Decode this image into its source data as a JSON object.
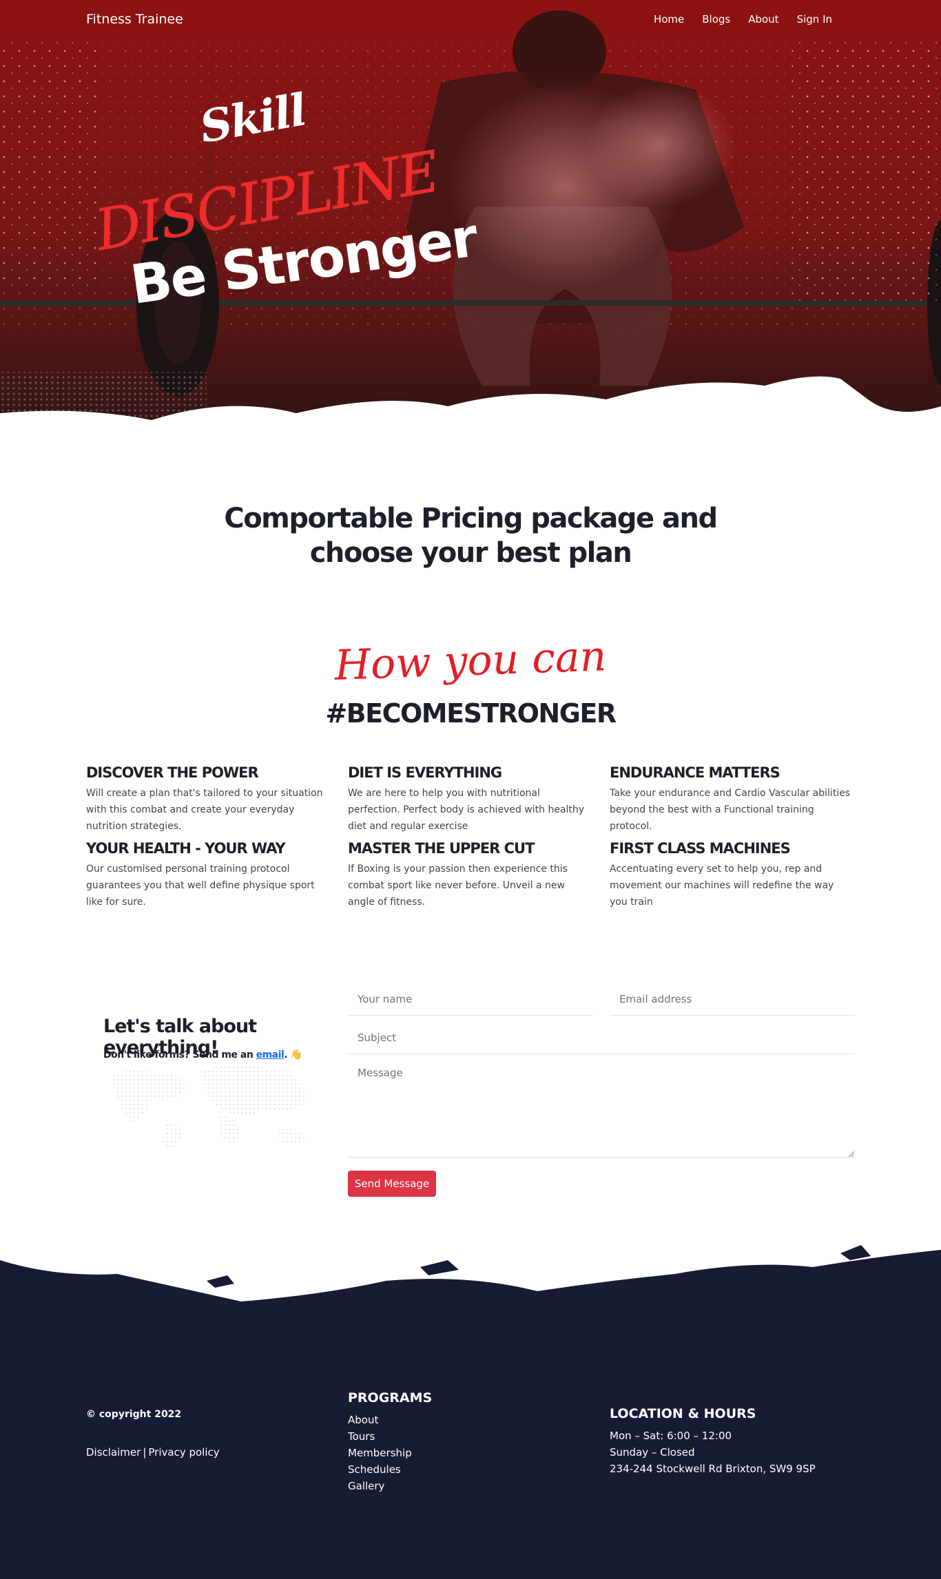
{
  "nav": {
    "brand": "Fitness Trainee",
    "links": [
      "Home",
      "Blogs",
      "About",
      "Sign In"
    ]
  },
  "hero": {
    "line1": "Skill",
    "line2": "DISCIPLINE",
    "line3": "Be Stronger"
  },
  "pricing": {
    "title_line1": "Comportable Pricing package and",
    "title_line2": "choose your best plan"
  },
  "how": {
    "script": "How you can",
    "hashtag": "#BECOMESTRONGER"
  },
  "features": [
    {
      "title": "DISCOVER THE POWER",
      "text": "Will create a plan that's tailored to your situation with this combat and create your everyday nutrition strategies."
    },
    {
      "title": "DIET IS EVERYTHING",
      "text": "We are here to help you with nutritional perfection. Perfect body is achieved with healthy diet and regular exercise"
    },
    {
      "title": "ENDURANCE MATTERS",
      "text": "Take your endurance and Cardio Vascular abilities beyond the best with a Functional training protocol."
    },
    {
      "title": "YOUR HEALTH - YOUR WAY",
      "text": "Our customised personal training protocol guarantees you that well define physique sport like for sure."
    },
    {
      "title": "MASTER THE UPPER CUT",
      "text": "If Boxing is your passion then experience this combat sport like never before. Unveil a new angle of fitness."
    },
    {
      "title": "FIRST CLASS MACHINES",
      "text": "Accentuating every set to help you, rep and movement our machines will redefine the way you train"
    }
  ],
  "contact": {
    "title": "Let's talk about everything!",
    "sub_prefix": "Don't like forms? Send me an",
    "sub_link": "email",
    "sub_suffix": ". 👋",
    "name_placeholder": "Your name",
    "email_placeholder": "Email address",
    "subject_placeholder": "Subject",
    "message_placeholder": "Message",
    "send_label": "Send Message"
  },
  "footer": {
    "copyright": "© copyright 2022",
    "disclaimer": "Disclaimer",
    "separator": "|",
    "privacy": "Privacy policy",
    "programs_title": "PROGRAMS",
    "programs": [
      "About",
      "Tours",
      "Membership",
      "Schedules",
      "Gallery"
    ],
    "location_title": "LOCATION & HOURS",
    "location_lines": [
      "Mon – Sat: 6:00 – 12:00",
      "Sunday – Closed",
      "234-244 Stockwell Rd Brixton, SW9 9SP"
    ]
  },
  "colors": {
    "hero_red": "#8a1414",
    "accent_red": "#e31e24",
    "button_red": "#dc3545",
    "footer_navy": "#171b33",
    "heading_dark": "#1d1f2b"
  }
}
